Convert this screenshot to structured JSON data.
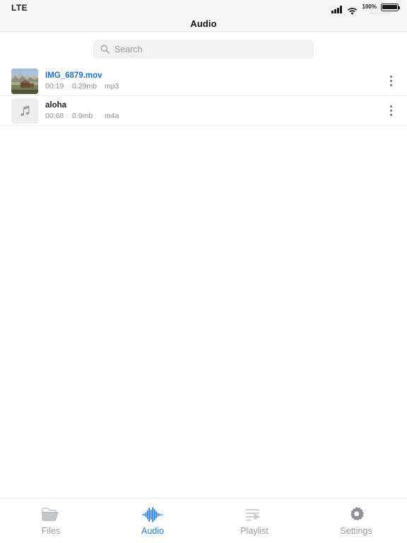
{
  "status_bar": {
    "carrier": "LTE",
    "signal_icon": "cellular-signal-icon",
    "wifi_icon": "wifi-icon",
    "battery_percent": "100%",
    "battery_icon": "battery-full-icon"
  },
  "header": {
    "title": "Audio"
  },
  "search": {
    "icon": "search-icon",
    "placeholder": "Search",
    "value": ""
  },
  "list": {
    "items": [
      {
        "title": "IMG_6879.mov",
        "duration": "00:19",
        "size": "0.29mb",
        "format": "mp3",
        "thumb_type": "photo",
        "title_color": "#1f6fd0",
        "menu_icon": "more-vertical-icon"
      },
      {
        "title": "aloha",
        "duration": "00:68",
        "size": "0.9mb",
        "format": "m4a",
        "thumb_type": "music-note",
        "title_color": "#1c1c1c",
        "menu_icon": "more-vertical-icon"
      }
    ]
  },
  "tabbar": {
    "active": "Audio",
    "accent_color": "#1f7bf0",
    "inactive_color": "#9a9a9a",
    "tabs": [
      {
        "label": "Files",
        "icon": "folder-icon"
      },
      {
        "label": "Audio",
        "icon": "waveform-icon"
      },
      {
        "label": "Playlist",
        "icon": "playlist-icon"
      },
      {
        "label": "Settings",
        "icon": "gear-icon"
      }
    ]
  }
}
